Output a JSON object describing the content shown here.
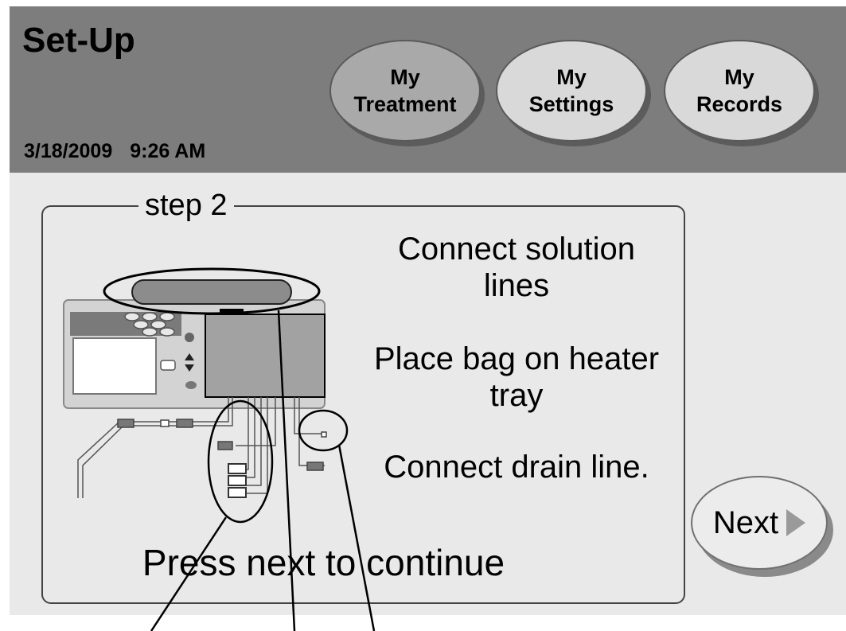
{
  "header": {
    "title": "Set-Up",
    "date": "3/18/2009",
    "time": "9:26 AM",
    "nav": [
      {
        "line1": "My",
        "line2": "Treatment"
      },
      {
        "line1": "My",
        "line2": "Settings"
      },
      {
        "line1": "My",
        "line2": "Records"
      }
    ]
  },
  "step": {
    "legend": "step 2",
    "instructions": {
      "solution": "Connect solution lines",
      "bag": "Place bag on heater tray",
      "drain": "Connect drain line.",
      "continue": "Press next to continue"
    }
  },
  "next": {
    "label": "Next",
    "icon": "play-arrow-icon"
  },
  "colors": {
    "header": "#7d7d7d",
    "panel": "#e9e9e9",
    "active_tab": "#a9a9a9",
    "tab": "#d9d9d9"
  }
}
